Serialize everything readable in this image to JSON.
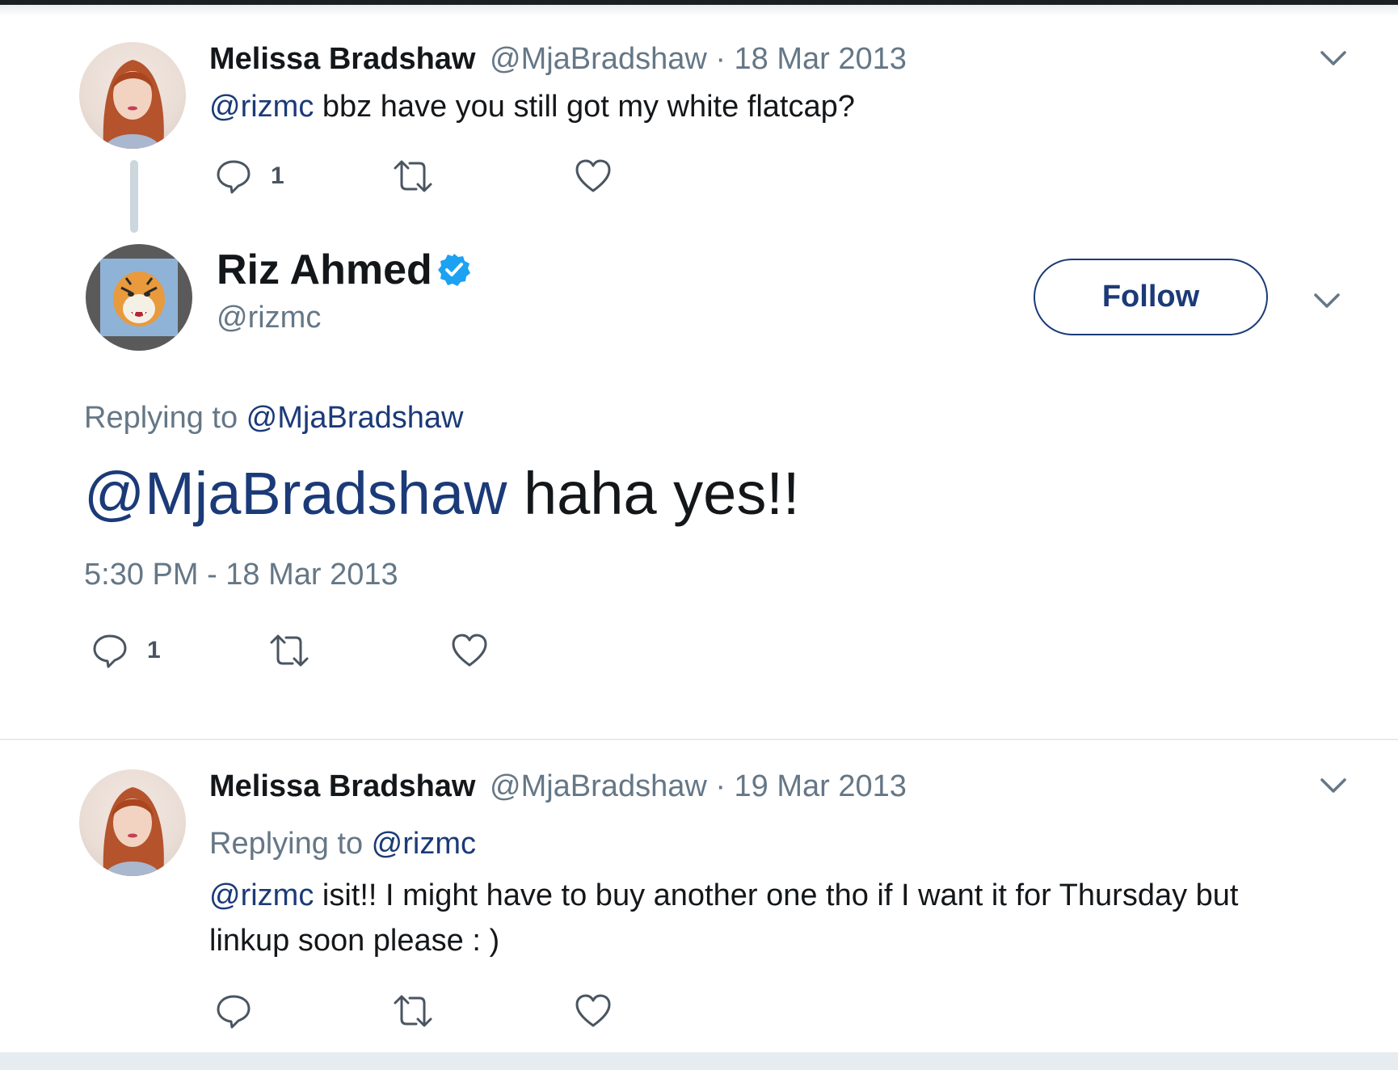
{
  "colors": {
    "link": "#1b3a78",
    "muted": "#657786",
    "verified": "#1da1f2"
  },
  "tweet1": {
    "name": "Melissa Bradshaw",
    "meta": "@MjaBradshaw · 18 Mar 2013",
    "mention": "@rizmc",
    "text": " bbz have you still got my white flatcap?",
    "reply_count": "1"
  },
  "main_tweet": {
    "name": "Riz Ahmed",
    "handle": "@rizmc",
    "follow_label": "Follow",
    "replying_prefix": "Replying to ",
    "replying_handle": "@MjaBradshaw",
    "mention": "@MjaBradshaw",
    "text": " haha yes!!",
    "timestamp": "5:30 PM - 18 Mar 2013",
    "reply_count": "1"
  },
  "tweet3": {
    "name": "Melissa Bradshaw",
    "meta": "@MjaBradshaw · 19 Mar 2013",
    "replying_prefix": "Replying to ",
    "replying_handle": "@rizmc",
    "mention": "@rizmc",
    "text_line1": " isit!! I might have to buy another one tho if I want it for Thursday but",
    "text_line2": "linkup soon please : )"
  }
}
